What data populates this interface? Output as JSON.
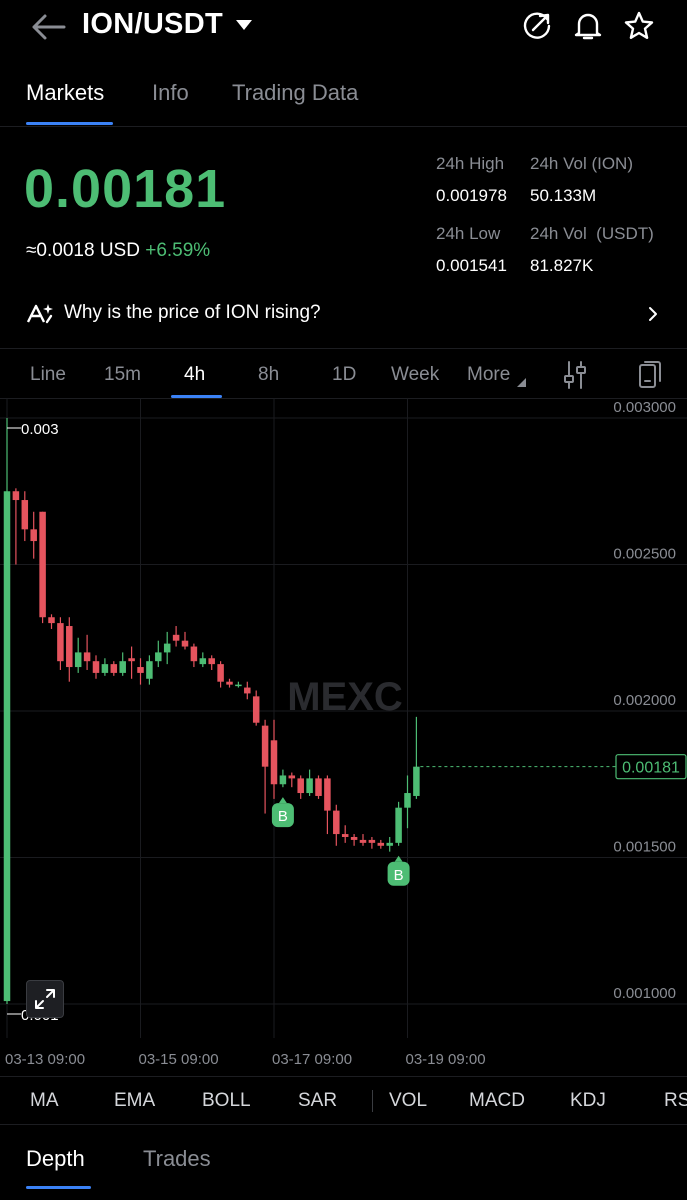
{
  "header": {
    "pair": "ION/USDT",
    "icons": [
      "back-arrow-icon",
      "caret-down-icon",
      "refresh-icon",
      "bell-icon",
      "star-icon"
    ]
  },
  "tabs": [
    {
      "label": "Markets",
      "active": true
    },
    {
      "label": "Info",
      "active": false
    },
    {
      "label": "Trading Data",
      "active": false
    }
  ],
  "ticker": {
    "price": "0.00181",
    "usd_approx": "≈0.0018",
    "usd_unit": "USD",
    "change": "+6.59%",
    "high_label": "24h High",
    "high_value": "0.001978",
    "vol_base_label": "24h Vol (ION)",
    "vol_base_value": "50.133M",
    "low_label": "24h Low",
    "low_value": "0.001541",
    "vol_quote_label": "24h Vol  (USDT)",
    "vol_quote_value": "81.827K"
  },
  "insight": {
    "text": "Why is the price of ION rising?"
  },
  "intervals": [
    {
      "label": "Line",
      "active": false
    },
    {
      "label": "15m",
      "active": false
    },
    {
      "label": "4h",
      "active": true
    },
    {
      "label": "8h",
      "active": false
    },
    {
      "label": "1D",
      "active": false
    },
    {
      "label": "Week",
      "active": false
    },
    {
      "label": "More",
      "active": false
    }
  ],
  "chart_data": {
    "type": "candlestick",
    "watermark": "MEXC",
    "y_ticks": [
      "0.003000",
      "0.002500",
      "0.002000",
      "0.001500",
      "0.001000"
    ],
    "ylim": [
      0.001,
      0.003
    ],
    "x_ticks": [
      "03-13 09:00",
      "03-15 09:00",
      "03-17 09:00",
      "03-19 09:00"
    ],
    "high_marker": "0.003",
    "low_marker": "0.001",
    "last_price": "0.00181",
    "trade_marker": "B",
    "colors": {
      "up": "#4dbd74",
      "down": "#e5545e",
      "last": "#4dbd74"
    },
    "candles": [
      [
        0.00101,
        0.00275,
        0.003,
        0.001
      ],
      [
        0.00275,
        0.00272,
        0.00276,
        0.0025
      ],
      [
        0.00272,
        0.00262,
        0.00275,
        0.00258
      ],
      [
        0.00262,
        0.00258,
        0.00268,
        0.00252
      ],
      [
        0.00268,
        0.00232,
        0.00268,
        0.0023
      ],
      [
        0.00232,
        0.0023,
        0.00233,
        0.00228
      ],
      [
        0.0023,
        0.00217,
        0.00232,
        0.00214
      ],
      [
        0.00229,
        0.00215,
        0.00232,
        0.0021
      ],
      [
        0.00215,
        0.0022,
        0.00225,
        0.00213
      ],
      [
        0.0022,
        0.00217,
        0.00226,
        0.00214
      ],
      [
        0.00217,
        0.00213,
        0.00219,
        0.00211
      ],
      [
        0.00213,
        0.00216,
        0.00218,
        0.00212
      ],
      [
        0.00216,
        0.00213,
        0.00217,
        0.00212
      ],
      [
        0.00213,
        0.00217,
        0.0022,
        0.00212
      ],
      [
        0.00218,
        0.00217,
        0.00222,
        0.00211
      ],
      [
        0.00215,
        0.00213,
        0.00218,
        0.00209
      ],
      [
        0.00211,
        0.00217,
        0.00219,
        0.00209
      ],
      [
        0.00217,
        0.0022,
        0.00224,
        0.00215
      ],
      [
        0.0022,
        0.00223,
        0.00227,
        0.00216
      ],
      [
        0.00226,
        0.00224,
        0.00229,
        0.00222
      ],
      [
        0.00224,
        0.00222,
        0.00227,
        0.00221
      ],
      [
        0.00222,
        0.00217,
        0.00223,
        0.00215
      ],
      [
        0.00216,
        0.00218,
        0.0022,
        0.00215
      ],
      [
        0.00218,
        0.00216,
        0.00219,
        0.00214
      ],
      [
        0.00216,
        0.0021,
        0.00217,
        0.00208
      ],
      [
        0.0021,
        0.00209,
        0.00211,
        0.00208
      ],
      [
        0.00209,
        0.00209,
        0.0021,
        0.00208
      ],
      [
        0.00208,
        0.00206,
        0.0021,
        0.00204
      ],
      [
        0.00205,
        0.00196,
        0.00207,
        0.00195
      ],
      [
        0.00195,
        0.00181,
        0.00197,
        0.00165
      ],
      [
        0.0019,
        0.00175,
        0.00197,
        0.0017
      ],
      [
        0.00175,
        0.00178,
        0.0018,
        0.00174
      ],
      [
        0.00178,
        0.00177,
        0.00179,
        0.00174
      ],
      [
        0.00177,
        0.00172,
        0.00178,
        0.0017
      ],
      [
        0.00172,
        0.00177,
        0.0018,
        0.00171
      ],
      [
        0.00177,
        0.00171,
        0.00178,
        0.0017
      ],
      [
        0.00177,
        0.00166,
        0.00178,
        0.00158
      ],
      [
        0.00166,
        0.00158,
        0.00168,
        0.00154
      ],
      [
        0.00158,
        0.00157,
        0.00161,
        0.00155
      ],
      [
        0.00157,
        0.00156,
        0.00158,
        0.00154
      ],
      [
        0.00156,
        0.00155,
        0.00158,
        0.00154
      ],
      [
        0.00156,
        0.00155,
        0.00157,
        0.00153
      ],
      [
        0.00155,
        0.00154,
        0.00156,
        0.00153
      ],
      [
        0.00154,
        0.00155,
        0.00157,
        0.00152
      ],
      [
        0.00155,
        0.00167,
        0.00169,
        0.00154
      ],
      [
        0.00167,
        0.00172,
        0.00178,
        0.0016
      ],
      [
        0.00171,
        0.00181,
        0.00198,
        0.0017
      ]
    ]
  },
  "indicators": [
    "MA",
    "EMA",
    "BOLL",
    "SAR",
    "VOL",
    "MACD",
    "KDJ",
    "RS"
  ],
  "bottom_tabs": [
    {
      "label": "Depth",
      "active": true
    },
    {
      "label": "Trades",
      "active": false
    }
  ]
}
